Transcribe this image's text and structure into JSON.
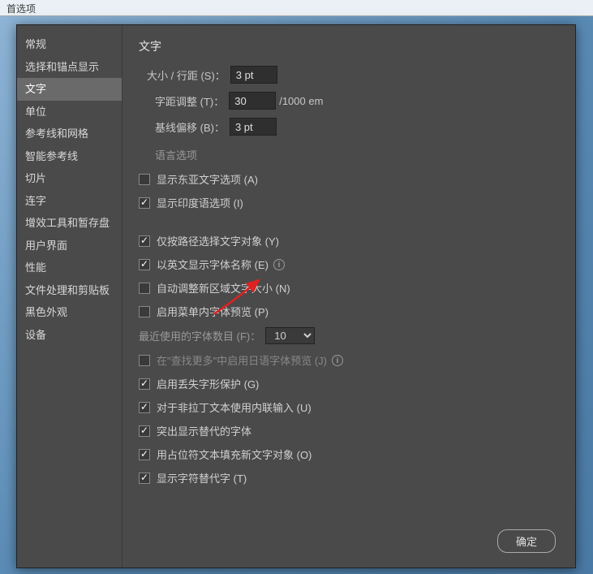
{
  "titlebar": "首选项",
  "sidebar": {
    "items": [
      "常规",
      "选择和锚点显示",
      "文字",
      "单位",
      "参考线和网格",
      "智能参考线",
      "切片",
      "连字",
      "增效工具和暂存盘",
      "用户界面",
      "性能",
      "文件处理和剪贴板",
      "黑色外观",
      "设备"
    ],
    "active_index": 2
  },
  "content": {
    "title": "文字",
    "size_leading": {
      "label": "大小 / 行距 (S)：",
      "value": "3 pt"
    },
    "tracking": {
      "label": "字距调整 (T)：",
      "value": "30",
      "suffix": "/1000 em"
    },
    "baseline": {
      "label": "基线偏移 (B)：",
      "value": "3 pt"
    },
    "language_section": "语言选项",
    "checkboxes": {
      "east_asian": {
        "label": "显示东亚文字选项 (A)",
        "checked": false
      },
      "indic": {
        "label": "显示印度语选项 (I)",
        "checked": true
      },
      "path_select": {
        "label": "仅按路径选择文字对象 (Y)",
        "checked": true
      },
      "english_font": {
        "label": "以英文显示字体名称 (E)",
        "checked": true,
        "info": true
      },
      "auto_resize": {
        "label": "自动调整新区域文字大小 (N)",
        "checked": false
      },
      "font_preview": {
        "label": "启用菜单内字体预览 (P)",
        "checked": false
      },
      "japanese_find": {
        "label": "在\"查找更多\"中启用日语字体预览 (J)",
        "checked": false,
        "info": true,
        "disabled": true
      },
      "missing_glyph": {
        "label": "启用丢失字形保护 (G)",
        "checked": true
      },
      "inline_input": {
        "label": "对于非拉丁文本使用内联输入 (U)",
        "checked": true
      },
      "highlight_alt": {
        "label": "突出显示替代的字体",
        "checked": true
      },
      "placeholder_fill": {
        "label": "用占位符文本填充新文字对象 (O)",
        "checked": true
      },
      "glyph_alt": {
        "label": "显示字符替代字 (T)",
        "checked": true
      }
    },
    "recent_fonts": {
      "label": "最近使用的字体数目 (F)：",
      "value": "10"
    },
    "ok_button": "确定"
  }
}
